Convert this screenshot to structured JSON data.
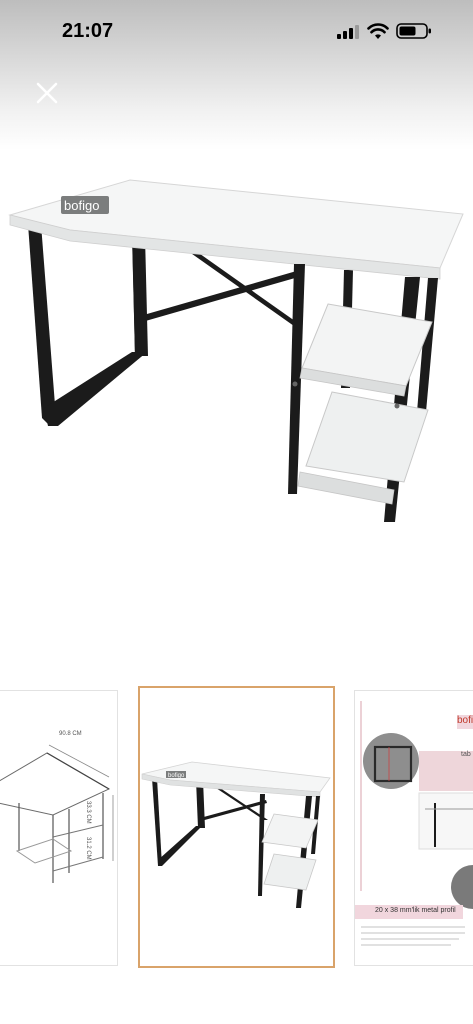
{
  "status_bar": {
    "time": "21:07"
  },
  "product": {
    "brand_label": "bofigo"
  },
  "thumbnails": {
    "dimension_width": "90.8 CM",
    "dimension_height_top": "33.3 CM",
    "dimension_height_bottom": "31.2 CM",
    "detail_brand": "bofi",
    "detail_tab_label": "tab",
    "detail_caption": "20 x 38 mm'lik metal profil"
  },
  "icons": {
    "close": "close-icon",
    "signal": "cellular-signal-icon",
    "wifi": "wifi-icon",
    "battery": "battery-icon"
  },
  "colors": {
    "thumbnail_selected_border": "#d9a36a",
    "frame": "#1b1b1b",
    "desk_top": "#f5f6f6"
  }
}
